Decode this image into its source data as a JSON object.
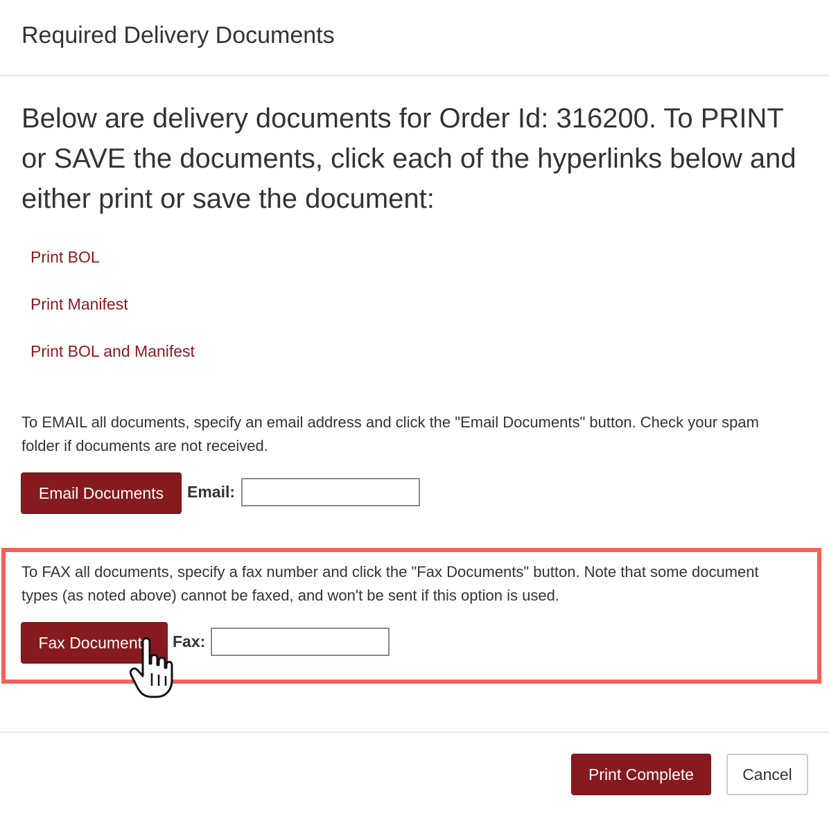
{
  "dialog": {
    "title": "Required Delivery Documents",
    "intro": "Below are delivery documents for Order Id: 316200. To PRINT or SAVE the documents, click each of the hyperlinks below and either print or save the document:"
  },
  "links": [
    {
      "label": "Print BOL"
    },
    {
      "label": "Print Manifest"
    },
    {
      "label": "Print BOL and Manifest"
    }
  ],
  "email": {
    "instructions": "To EMAIL all documents, specify an email address and click the \"Email Documents\" button. Check your spam folder if documents are not received.",
    "button_label": "Email Documents",
    "field_label": "Email:",
    "value": ""
  },
  "fax": {
    "instructions": "To FAX all documents, specify a fax number and click the \"Fax Documents\" button. Note that some document types (as noted above) cannot be faxed, and won't be sent if this option is used.",
    "button_label": "Fax Documents",
    "field_label": "Fax:",
    "value": ""
  },
  "footer": {
    "print_complete_label": "Print Complete",
    "cancel_label": "Cancel"
  },
  "colors": {
    "brand": "#861a1e",
    "link": "#8b1a1e",
    "highlight": "#f2615a"
  },
  "icons": {
    "cursor": "hand-pointer-icon"
  }
}
